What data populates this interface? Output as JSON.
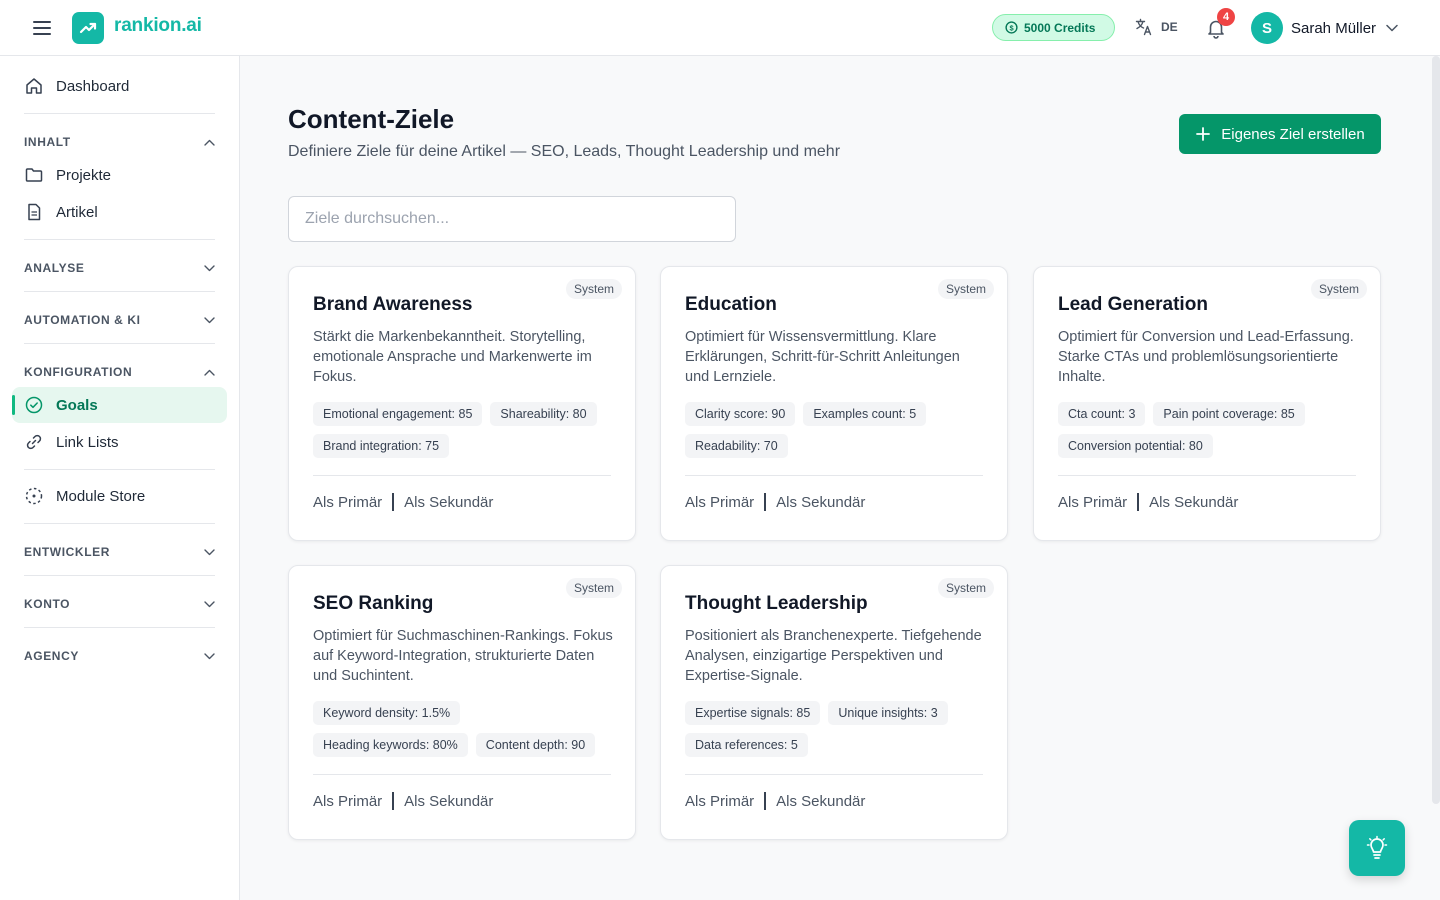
{
  "header": {
    "logo_text": "rankion.ai",
    "credits": "5000 Credits",
    "language": "DE",
    "notifications_count": "4",
    "user_initial": "S",
    "user_name": "Sarah Müller"
  },
  "sidebar": {
    "dashboard": "Dashboard",
    "section_inhalt": "INHALT",
    "projekte": "Projekte",
    "artikel": "Artikel",
    "section_analyse": "ANALYSE",
    "section_automation": "AUTOMATION & KI",
    "section_konfiguration": "KONFIGURATION",
    "goals": "Goals",
    "link_lists": "Link Lists",
    "module_store": "Module Store",
    "section_entwickler": "ENTWICKLER",
    "section_konto": "KONTO",
    "section_agency": "AGENCY"
  },
  "main": {
    "title": "Content-Ziele",
    "subtitle": "Definiere Ziele für deine Artikel — SEO, Leads, Thought Leadership und mehr",
    "create_button": "Eigenes Ziel erstellen",
    "search_placeholder": "Ziele durchsuchen..."
  },
  "cards": [
    {
      "badge": "System",
      "title": "Brand Awareness",
      "description": "Stärkt die Markenbekanntheit. Storytelling, emotionale Ansprache und Markenwerte im Fokus.",
      "metrics": [
        "Emotional engagement: 85",
        "Shareability: 80",
        "Brand integration: 75"
      ],
      "primary": "Als Primär",
      "secondary": "Als Sekundär"
    },
    {
      "badge": "System",
      "title": "Education",
      "description": "Optimiert für Wissensvermittlung. Klare Erklärungen, Schritt-für-Schritt Anleitungen und Lernziele.",
      "metrics": [
        "Clarity score: 90",
        "Examples count: 5",
        "Readability: 70"
      ],
      "primary": "Als Primär",
      "secondary": "Als Sekundär"
    },
    {
      "badge": "System",
      "title": "Lead Generation",
      "description": "Optimiert für Conversion und Lead-Erfassung. Starke CTAs und problemlösungsorientierte Inhalte.",
      "metrics": [
        "Cta count: 3",
        "Pain point coverage: 85",
        "Conversion potential: 80"
      ],
      "primary": "Als Primär",
      "secondary": "Als Sekundär"
    },
    {
      "badge": "System",
      "title": "SEO Ranking",
      "description": "Optimiert für Suchmaschinen-Rankings. Fokus auf Keyword-Integration, strukturierte Daten und Suchintent.",
      "metrics": [
        "Keyword density: 1.5%",
        "Heading keywords: 80%",
        "Content depth: 90"
      ],
      "primary": "Als Primär",
      "secondary": "Als Sekundär"
    },
    {
      "badge": "System",
      "title": "Thought Leadership",
      "description": "Positioniert als Branchenexperte. Tiefgehende Analysen, einzigartige Perspektiven und Expertise-Signale.",
      "metrics": [
        "Expertise signals: 85",
        "Unique insights: 3",
        "Data references: 5"
      ],
      "primary": "Als Primär",
      "secondary": "Als Sekundär"
    }
  ],
  "colors": {
    "brand": "#14b8a6",
    "primary_button": "#059669",
    "active_nav_bg": "#e6f7ef",
    "badge_red": "#ef4444"
  },
  "icons": {
    "menu": "hamburger-icon",
    "logo": "trending-up-icon",
    "credits": "coin-icon",
    "language": "translate-icon",
    "notifications": "bell-icon",
    "fab": "lightbulb-icon"
  }
}
